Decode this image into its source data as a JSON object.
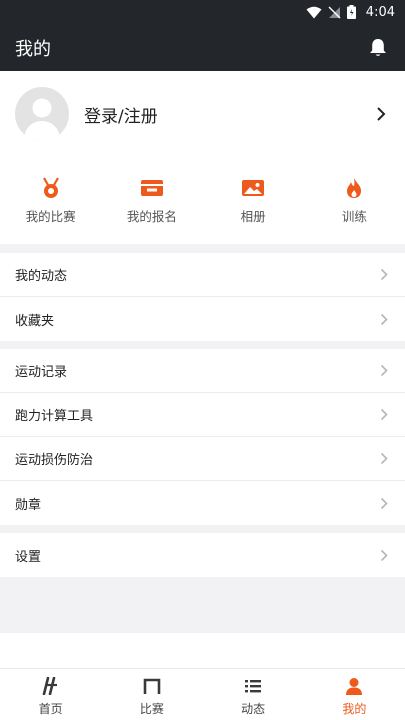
{
  "status_bar": {
    "time": "4:04"
  },
  "header": {
    "title": "我的"
  },
  "profile": {
    "login_label": "登录/注册"
  },
  "shortcuts": [
    {
      "label": "我的比赛",
      "icon": "medal-icon"
    },
    {
      "label": "我的报名",
      "icon": "ticket-icon"
    },
    {
      "label": "相册",
      "icon": "photo-album-icon"
    },
    {
      "label": "训练",
      "icon": "flame-icon"
    }
  ],
  "menu": {
    "group1": [
      "我的动态",
      "收藏夹"
    ],
    "group2": [
      "运动记录",
      "跑力计算工具",
      "运动损伤防治",
      "勋章"
    ],
    "group3": [
      "设置"
    ]
  },
  "tab_bar": {
    "tabs": [
      {
        "label": "首页",
        "icon": "home-icon"
      },
      {
        "label": "比赛",
        "icon": "race-icon"
      },
      {
        "label": "动态",
        "icon": "feed-list-icon"
      },
      {
        "label": "我的",
        "icon": "profile-icon"
      }
    ],
    "active_index": 3
  },
  "colors": {
    "accent": "#ee5a1b",
    "header_bg": "#23262b",
    "page_bg": "#f2f2f4"
  }
}
